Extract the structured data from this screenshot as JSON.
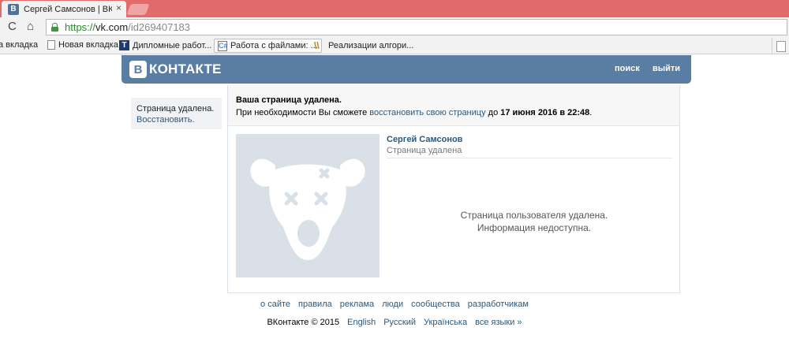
{
  "browser": {
    "tab_title": "Сергей Самсонов | ВКонт",
    "favicon_letter": "B",
    "url_scheme": "https://",
    "url_host": "vk.com",
    "url_path": "/id269407183",
    "bookmarks": [
      {
        "label": "а вкладка",
        "icon": "none"
      },
      {
        "label": "Новая вкладка",
        "icon": "page-icon"
      },
      {
        "label": "Дипломные работ...",
        "icon": "t-icon",
        "glyph": "T"
      },
      {
        "label": "Работа с файлами: ...",
        "icon": "c-icon",
        "glyph": "C#"
      },
      {
        "label": "Реализации алгори...",
        "icon": "wave-icon",
        "glyph": "\\\\"
      }
    ]
  },
  "header": {
    "logo_mark": "B",
    "logo_text": "КОНТАКТЕ",
    "search_label": "поиск",
    "logout_label": "выйти"
  },
  "sidebar": {
    "line1": "Страница удалена.",
    "restore_link": "Восстановить."
  },
  "notice": {
    "title": "Ваша страница удалена.",
    "text_before": "При необходимости Вы сможете ",
    "link": "восстановить свою страницу",
    "text_mid": " до ",
    "date": "17 июня 2016 в 22:48",
    "text_end": "."
  },
  "profile": {
    "name": "Сергей Самсонов",
    "status": "Страница удалена",
    "message_line1": "Страница пользователя удалена.",
    "message_line2": "Информация недоступна."
  },
  "footer": {
    "links": [
      "о сайте",
      "правила",
      "реклама",
      "люди",
      "сообщества",
      "разработчикам"
    ],
    "copyright": "ВКонтакте © 2015",
    "languages": [
      "English",
      "Русский",
      "Українська",
      "все языки »"
    ]
  },
  "colors": {
    "brand": "#597da3",
    "link": "#2b587a",
    "avatar_bg": "#d9e0e8"
  }
}
